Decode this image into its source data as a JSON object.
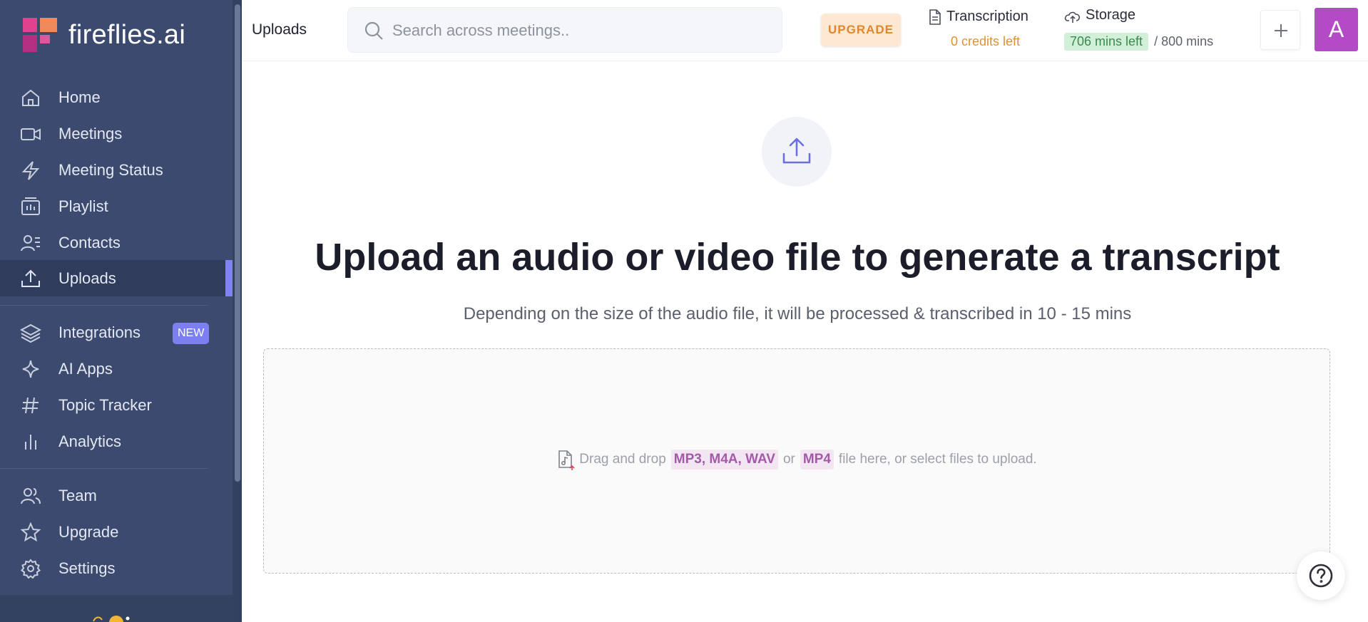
{
  "app": {
    "name": "fireflies.ai"
  },
  "sidebar": {
    "items": [
      {
        "key": "home",
        "label": "Home",
        "icon": "home-icon"
      },
      {
        "key": "meetings",
        "label": "Meetings",
        "icon": "video-camera-icon"
      },
      {
        "key": "meeting-status",
        "label": "Meeting Status",
        "icon": "lightning-icon"
      },
      {
        "key": "playlist",
        "label": "Playlist",
        "icon": "playlist-icon"
      },
      {
        "key": "contacts",
        "label": "Contacts",
        "icon": "contacts-icon"
      },
      {
        "key": "uploads",
        "label": "Uploads",
        "icon": "upload-icon",
        "active": true
      },
      {
        "key": "integrations",
        "label": "Integrations",
        "icon": "layers-icon",
        "badge": "NEW"
      },
      {
        "key": "ai-apps",
        "label": "AI Apps",
        "icon": "sparkle-icon"
      },
      {
        "key": "topic-tracker",
        "label": "Topic Tracker",
        "icon": "hashtag-icon"
      },
      {
        "key": "analytics",
        "label": "Analytics",
        "icon": "bar-chart-icon"
      },
      {
        "key": "team",
        "label": "Team",
        "icon": "team-icon"
      },
      {
        "key": "upgrade",
        "label": "Upgrade",
        "icon": "star-icon"
      },
      {
        "key": "settings",
        "label": "Settings",
        "icon": "gear-icon"
      }
    ]
  },
  "header": {
    "title": "Uploads",
    "search_placeholder": "Search across meetings..",
    "upgrade_label": "UPGRADE",
    "transcription": {
      "label": "Transcription",
      "credits": "0 credits left"
    },
    "storage": {
      "label": "Storage",
      "used": "706 mins left",
      "total": "/ 800 mins"
    },
    "avatar_initial": "A"
  },
  "main": {
    "heading": "Upload an audio or video file to generate a transcript",
    "subheading": "Depending on the size of the audio file, it will be processed & transcribed in 10 - 15 mins",
    "dropzone": {
      "prefix": "Drag and drop",
      "formats": "MP3, M4A, WAV",
      "or": "or",
      "format_alt": "MP4",
      "suffix": "file here, or select files to upload."
    }
  },
  "colors": {
    "sidebar_bg": "#3b4a6e",
    "accent": "#7f83f0",
    "avatar_bg": "#b34bc6",
    "upgrade_text": "#e38629"
  }
}
